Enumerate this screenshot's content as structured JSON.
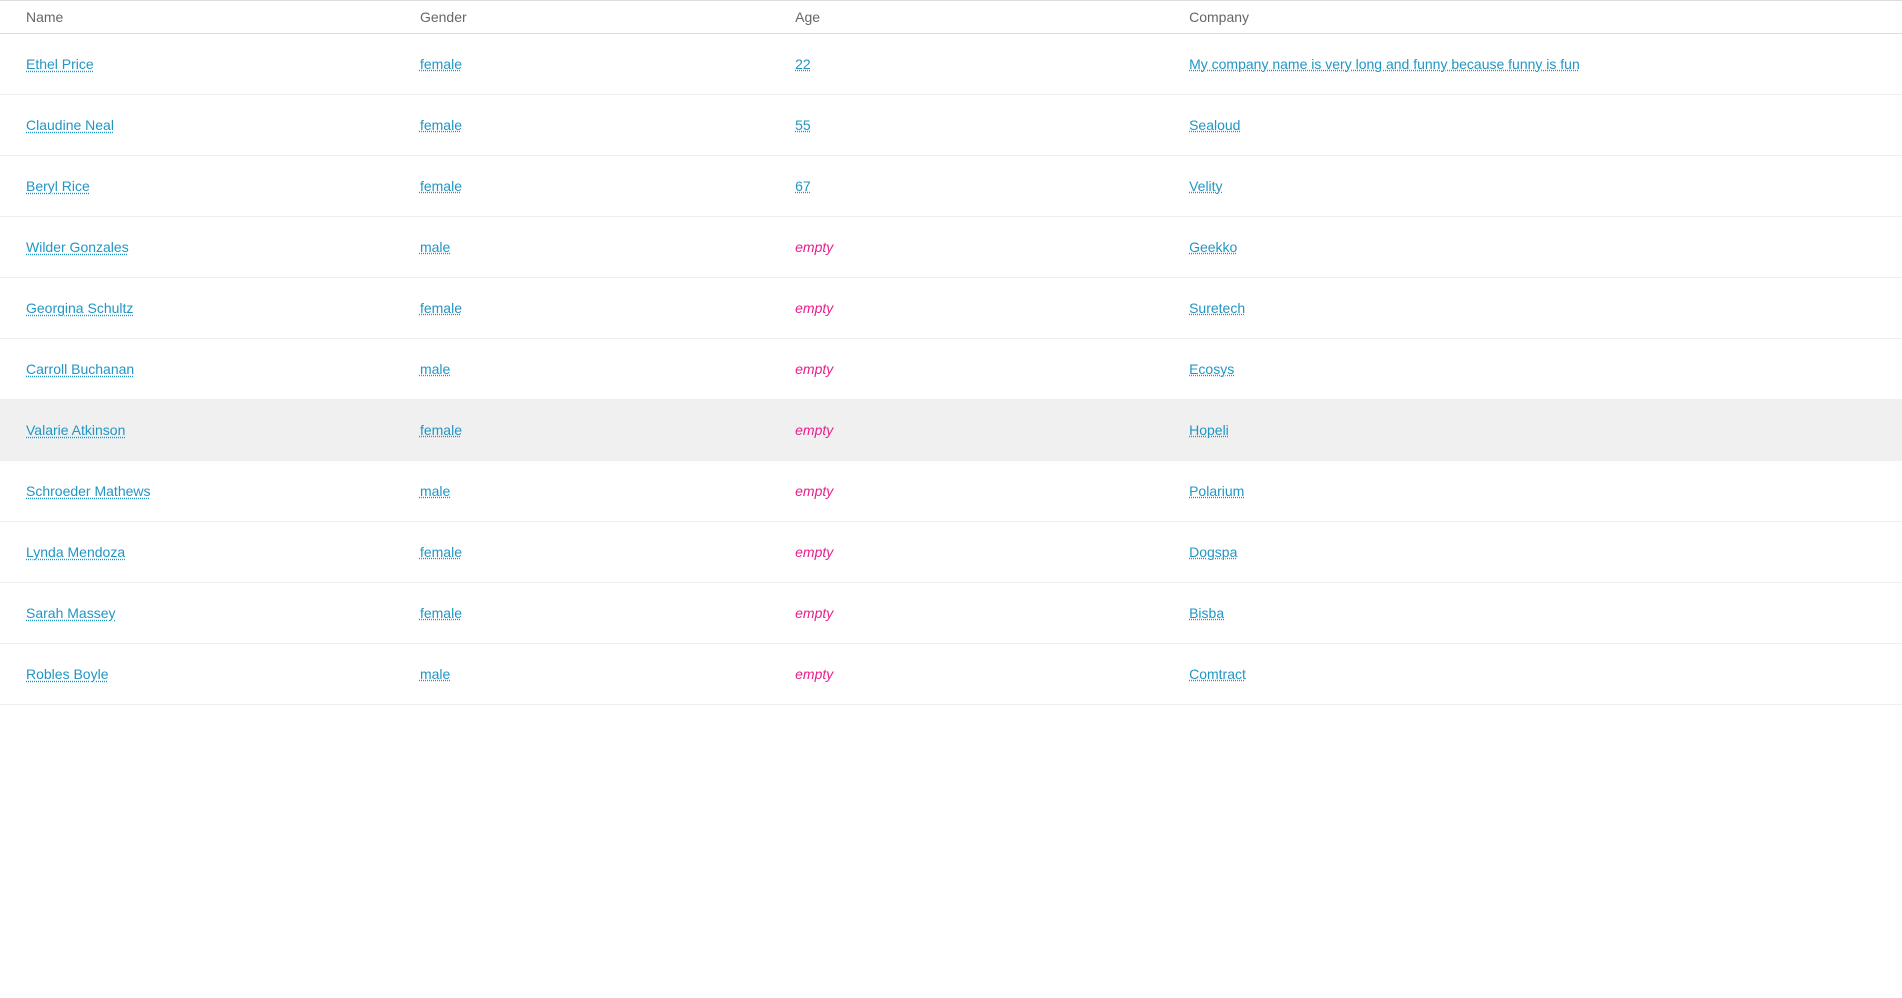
{
  "table": {
    "headers": {
      "name": "Name",
      "gender": "Gender",
      "age": "Age",
      "company": "Company"
    },
    "rows": [
      {
        "id": 1,
        "name": "Ethel Price",
        "gender": "female",
        "age": "22",
        "age_empty": false,
        "company": "My company name is very long and funny because funny is fun",
        "highlighted": false
      },
      {
        "id": 2,
        "name": "Claudine Neal",
        "gender": "female",
        "age": "55",
        "age_empty": false,
        "company": "Sealoud",
        "highlighted": false
      },
      {
        "id": 3,
        "name": "Beryl Rice",
        "gender": "female",
        "age": "67",
        "age_empty": false,
        "company": "Velity",
        "highlighted": false
      },
      {
        "id": 4,
        "name": "Wilder Gonzales",
        "gender": "male",
        "age": "empty",
        "age_empty": true,
        "company": "Geekko",
        "highlighted": false
      },
      {
        "id": 5,
        "name": "Georgina Schultz",
        "gender": "female",
        "age": "empty",
        "age_empty": true,
        "company": "Suretech",
        "highlighted": false
      },
      {
        "id": 6,
        "name": "Carroll Buchanan",
        "gender": "male",
        "age": "empty",
        "age_empty": true,
        "company": "Ecosys",
        "highlighted": false
      },
      {
        "id": 7,
        "name": "Valarie Atkinson",
        "gender": "female",
        "age": "empty",
        "age_empty": true,
        "company": "Hopeli",
        "highlighted": true
      },
      {
        "id": 8,
        "name": "Schroeder Mathews",
        "gender": "male",
        "age": "empty",
        "age_empty": true,
        "company": "Polarium",
        "highlighted": false
      },
      {
        "id": 9,
        "name": "Lynda Mendoza",
        "gender": "female",
        "age": "empty",
        "age_empty": true,
        "company": "Dogspa",
        "highlighted": false
      },
      {
        "id": 10,
        "name": "Sarah Massey",
        "gender": "female",
        "age": "empty",
        "age_empty": true,
        "company": "Bisba",
        "highlighted": false
      },
      {
        "id": 11,
        "name": "Robles Boyle",
        "gender": "male",
        "age": "empty",
        "age_empty": true,
        "company": "Comtract",
        "highlighted": false
      }
    ]
  }
}
